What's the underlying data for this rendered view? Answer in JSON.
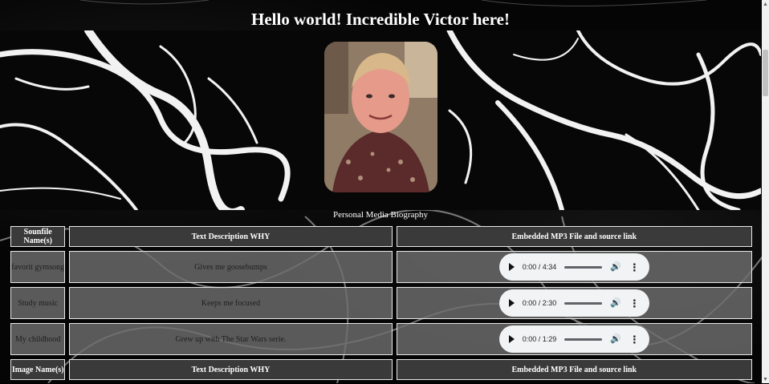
{
  "header": {
    "title": "Hello world! Incredible Victor here!"
  },
  "hero": {
    "caption": "Personal Media Biography"
  },
  "table": {
    "headers": [
      "Sounfile Name(s)",
      "Text Description WHY",
      "Embedded MP3 File and source link"
    ],
    "rows": [
      {
        "name": "favorit gymsong",
        "why": "Gives me goosebumps",
        "time": "0:00 / 4:34",
        "progress": 0
      },
      {
        "name": "Study music",
        "why": "Keeps me focused",
        "time": "0:00 / 2:30",
        "progress": 0
      },
      {
        "name": "My childhood",
        "why": "Grew up with The Star Wars serie.",
        "time": "0:00 / 1:29",
        "progress": 0
      }
    ],
    "second_headers": [
      "Image Name(s)",
      "Text Description WHY",
      "Embedded MP3 File and source link"
    ]
  },
  "icons": {
    "play": "play-icon",
    "volume": "volume-icon",
    "more": "more-options-icon"
  }
}
